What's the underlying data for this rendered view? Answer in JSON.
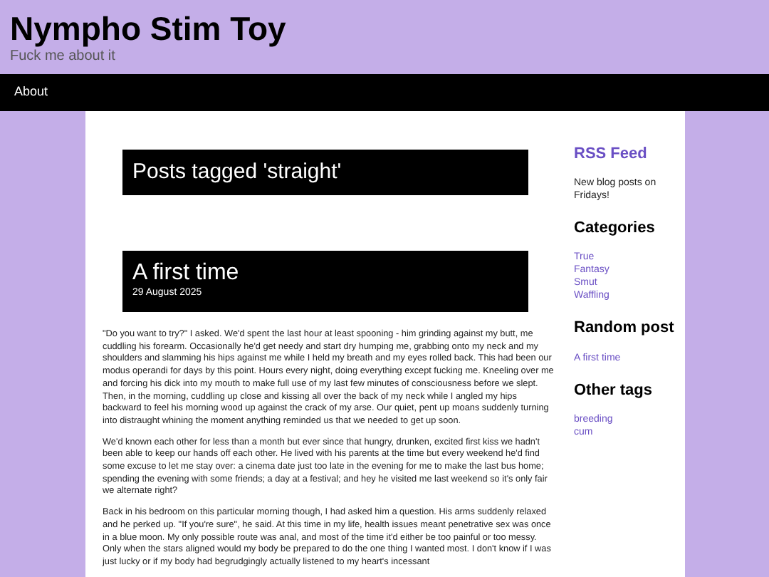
{
  "site": {
    "title": "Nympho Stim Toy",
    "tagline": "Fuck me about it"
  },
  "nav": [
    {
      "label": "About"
    }
  ],
  "page_heading": "Posts tagged 'straight'",
  "post": {
    "title": "A first time",
    "date": "29 August 2025",
    "paragraphs": [
      "\"Do you want to try?\" I asked. We'd spent the last hour at least spooning - him grinding against my butt, me cuddling his forearm. Occasionally he'd get needy and start dry humping me, grabbing onto my neck and my shoulders and slamming his hips against me while I held my breath and my eyes rolled back. This had been our modus operandi for days by this point. Hours every night, doing everything except fucking me. Kneeling over me and forcing his dick into my mouth to make full use of my last few minutes of consciousness before we slept. Then, in the morning, cuddling up close and kissing all over the back of my neck while I angled my hips backward to feel his morning wood up against the crack of my arse. Our quiet, pent up moans suddenly turning into distraught whining the moment anything reminded us that we needed to get up soon.",
      "We'd known each other for less than a month but ever since that hungry, drunken, excited first kiss we hadn't been able to keep our hands off each other. He lived with his parents at the time but every weekend he'd find some excuse to let me stay over: a cinema date just too late in the evening for me to make the last bus home; spending the evening with some friends; a day at a festival; and hey he visited me last weekend so it's only fair we alternate right?",
      "Back in his bedroom on this particular morning though, I had asked him a question. His arms suddenly relaxed and he perked up. \"If you're sure\", he said. At this time in my life, health issues meant penetrative sex was once in a blue moon. My only possible route was anal, and most of the time it'd either be too painful or too messy. Only when the stars aligned would my body be prepared to do the one thing I wanted most. I don't know if I was just lucky or if my body had begrudgingly actually listened to my heart's incessant"
    ]
  },
  "sidebar": {
    "rss_title": "RSS Feed",
    "rss_note": "New blog posts on Fridays!",
    "sections": [
      {
        "title": "Categories",
        "links": [
          "True",
          "Fantasy",
          "Smut",
          "Waffling"
        ]
      },
      {
        "title": "Random post",
        "links": [
          "A first time"
        ]
      },
      {
        "title": "Other tags",
        "links": [
          "breeding",
          "cum"
        ]
      }
    ]
  }
}
